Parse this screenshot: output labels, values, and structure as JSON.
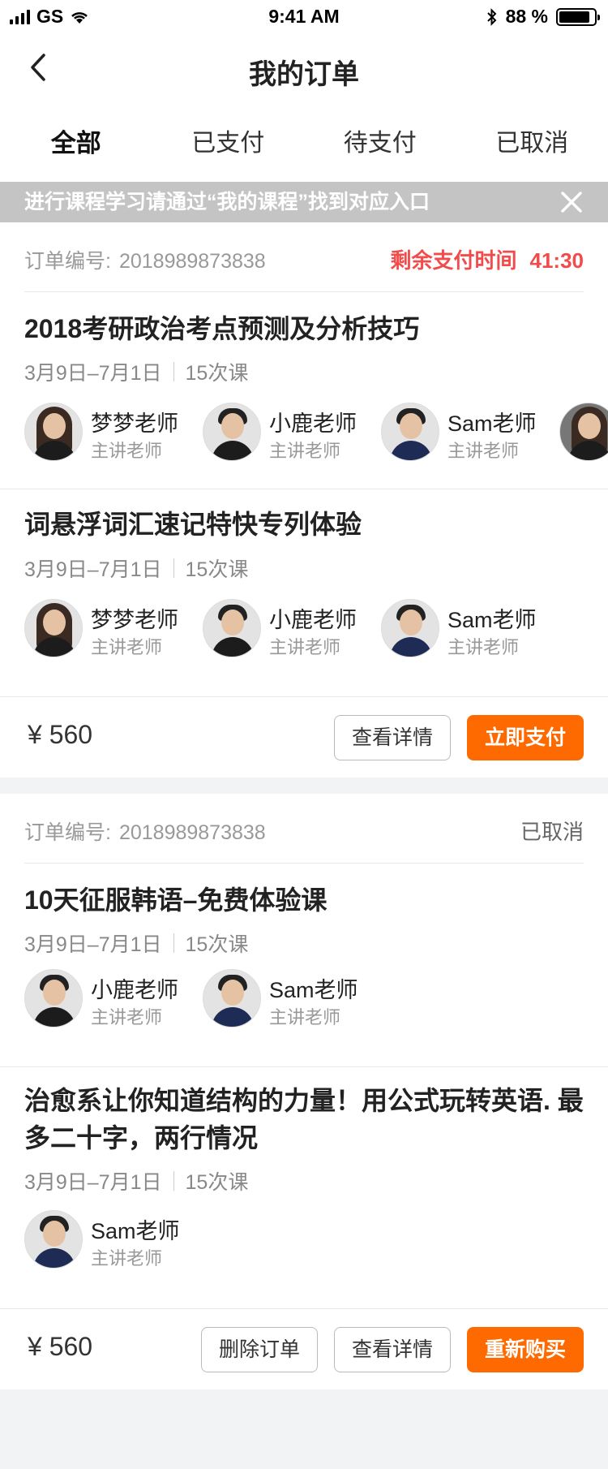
{
  "status_bar": {
    "carrier": "GS",
    "time": "9:41 AM",
    "battery": "88 %"
  },
  "nav": {
    "title": "我的订单"
  },
  "tabs": [
    {
      "label": "全部",
      "active": true
    },
    {
      "label": "已支付",
      "active": false
    },
    {
      "label": "待支付",
      "active": false
    },
    {
      "label": "已取消",
      "active": false
    }
  ],
  "notice": {
    "text": "进行课程学习请通过“我的课程”找到对应入口"
  },
  "orders": [
    {
      "order_label": "订单编号:",
      "order_no": "2018989873838",
      "status_label": "剩余支付时间",
      "timer": "41:30",
      "courses": [
        {
          "title": "2018考研政治考点预测及分析技巧",
          "dates": "3月9日–7月1日",
          "lessons": "15次课",
          "teachers": [
            {
              "name": "梦梦老师",
              "role": "主讲老师"
            },
            {
              "name": "小鹿老师",
              "role": "主讲老师"
            },
            {
              "name": "Sam老师",
              "role": "主讲老师"
            },
            {
              "name": "",
              "role": ""
            }
          ]
        },
        {
          "title": "词悬浮词汇速记特快专列体验",
          "dates": "3月9日–7月1日",
          "lessons": "15次课",
          "teachers": [
            {
              "name": "梦梦老师",
              "role": "主讲老师"
            },
            {
              "name": "小鹿老师",
              "role": "主讲老师"
            },
            {
              "name": "Sam老师",
              "role": "主讲老师"
            }
          ]
        }
      ],
      "price": "¥ 560",
      "buttons": {
        "detail": "查看详情",
        "pay": "立即支付"
      }
    },
    {
      "order_label": "订单编号:",
      "order_no": "2018989873838",
      "status_label": "已取消",
      "courses": [
        {
          "title": "10天征服韩语–免费体验课",
          "dates": "3月9日–7月1日",
          "lessons": "15次课",
          "teachers": [
            {
              "name": "小鹿老师",
              "role": "主讲老师"
            },
            {
              "name": "Sam老师",
              "role": "主讲老师"
            }
          ]
        },
        {
          "title": "治愈系让你知道结构的力量！用公式玩转英语. 最多二十字，两行情况",
          "dates": "3月9日–7月1日",
          "lessons": "15次课",
          "teachers": [
            {
              "name": "Sam老师",
              "role": "主讲老师"
            }
          ]
        }
      ],
      "price": "¥ 560",
      "buttons": {
        "delete": "删除订单",
        "detail": "查看详情",
        "rebuy": "重新购买"
      }
    }
  ]
}
